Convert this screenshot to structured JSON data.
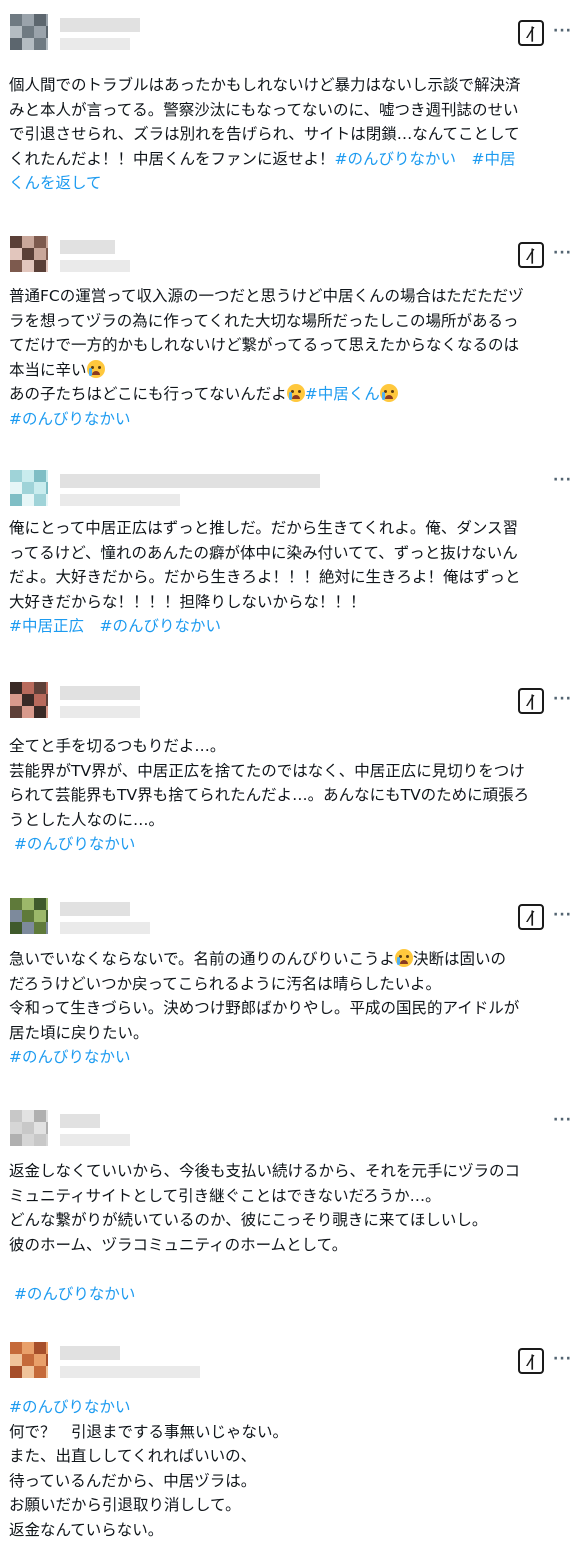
{
  "icons": {
    "grok": "grok-icon",
    "more": "more-options-icon"
  },
  "ui": {
    "grok_glyph": "⁄|",
    "more_glyph": "···"
  },
  "posts": [
    {
      "lines": [
        [
          {
            "t": "個人間でのトラブルはあったかもしれないけど暴力はないし示談で解決済"
          }
        ],
        [
          {
            "t": "みと本人が言ってる。警察沙汰にもなってないのに、嘘つき週刊誌のせい"
          }
        ],
        [
          {
            "t": "で引退させられ、ズラは別れを告げられ、サイトは閉鎖…なんてことして"
          }
        ],
        [
          {
            "t": "くれたんだよ！！中居くんをファンに返せよ！"
          },
          {
            "t": "#のんびりなかい　#中居",
            "tag": true
          }
        ],
        [
          {
            "t": "くんを返して",
            "tag": true
          }
        ]
      ]
    },
    {
      "lines": [
        [
          {
            "t": "普通FCの運営って収入源の一つだと思うけど中居くんの場合はただただヅ"
          }
        ],
        [
          {
            "t": "ラを想ってヅラの為に作ってくれた大切な場所だったしこの場所があるっ"
          }
        ],
        [
          {
            "t": "てだけで一方的かもしれないけど繋がってるって思えたからなくなるのは"
          }
        ],
        [
          {
            "t": "本当に辛い"
          },
          {
            "emoji": true
          }
        ],
        [
          {
            "t": "あの子たちはどこにも行ってないんだよ"
          },
          {
            "emoji": true
          },
          {
            "t": "#中居くん",
            "tag": true
          },
          {
            "emoji": true
          }
        ],
        [
          {
            "t": "#のんびりなかい",
            "tag": true
          }
        ]
      ]
    },
    {
      "lines": [
        [
          {
            "t": "俺にとって中居正広はずっと推しだ。だから生きてくれよ。俺、ダンス習"
          }
        ],
        [
          {
            "t": "ってるけど、憧れのあんたの癖が体中に染み付いてて、ずっと抜けないん"
          }
        ],
        [
          {
            "t": "だよ。大好きだから。だから生きろよ！！！絶対に生きろよ！俺はずっと"
          }
        ],
        [
          {
            "t": "大好きだからな！！！！担降りしないからな！！！"
          }
        ],
        [
          {
            "t": "#中居正広　#のんびりなかい",
            "tag": true
          }
        ]
      ]
    },
    {
      "lines": [
        [
          {
            "t": "全てと手を切るつもりだよ…。"
          }
        ],
        [
          {
            "t": "芸能界がTV界が、中居正広を捨てたのではなく、中居正広に見切りをつけ"
          }
        ],
        [
          {
            "t": "られて芸能界もTV界も捨てられたんだよ…。あんなにもTVのために頑張ろ"
          }
        ],
        [
          {
            "t": "うとした人なのに…。"
          }
        ],
        [
          {
            "t": " #のんびりなかい",
            "tag": true
          }
        ]
      ]
    },
    {
      "lines": [
        [
          {
            "t": "急いでいなくならないで。名前の通りのんびりいこうよ"
          },
          {
            "emoji": true
          },
          {
            "t": "決断は固いの"
          }
        ],
        [
          {
            "t": "だろうけどいつか戻ってこられるように汚名は晴らしたいよ。"
          }
        ],
        [
          {
            "t": "令和って生きづらい。決めつけ野郎ばかりやし。平成の国民的アイドルが"
          }
        ],
        [
          {
            "t": "居た頃に戻りたい。"
          }
        ],
        [
          {
            "t": "#のんびりなかい",
            "tag": true
          }
        ]
      ]
    },
    {
      "lines": [
        [
          {
            "t": "返金しなくていいから、今後も支払い続けるから、それを元手にヅラのコ"
          }
        ],
        [
          {
            "t": "ミュニティサイトとして引き継ぐことはできないだろうか…。"
          }
        ],
        [
          {
            "t": "どんな繋がりが続いているのか、彼にこっそり覗きに来てほしいし。"
          }
        ],
        [
          {
            "t": "彼のホーム、ヅラコミュニティのホームとして。"
          }
        ],
        [
          {
            "t": " "
          }
        ],
        [
          {
            "t": " #のんびりなかい",
            "tag": true
          }
        ]
      ]
    },
    {
      "lines": [
        [
          {
            "t": "#のんびりなかい",
            "tag": true
          }
        ],
        [
          {
            "t": "何で？　引退までする事無いじゃない。"
          }
        ],
        [
          {
            "t": "また、出直ししてくれればいいの、"
          }
        ],
        [
          {
            "t": "待っているんだから、中居ヅラは。"
          }
        ],
        [
          {
            "t": "お願いだから引退取り消しして。"
          }
        ],
        [
          {
            "t": "返金なんていらない。"
          }
        ]
      ]
    }
  ]
}
